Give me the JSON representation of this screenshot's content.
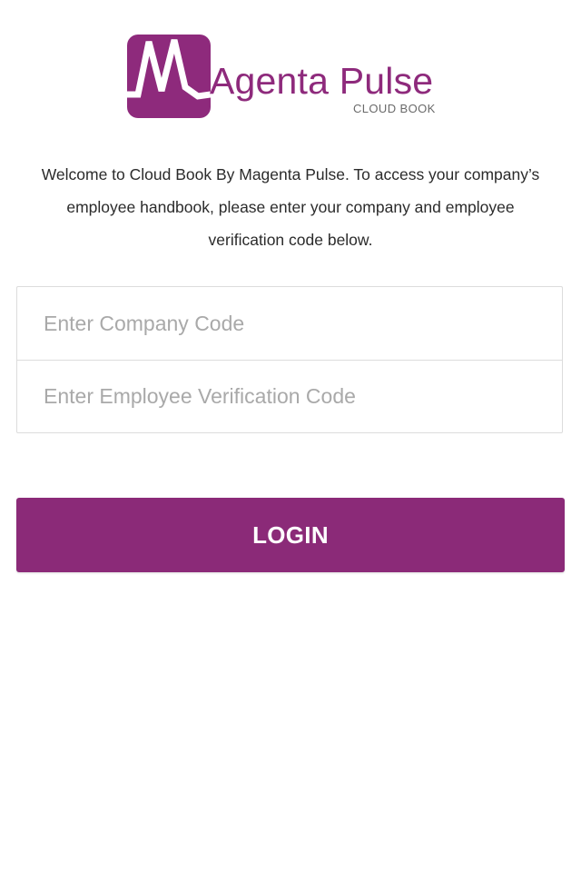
{
  "brand": {
    "name": "Agenta Pulse",
    "subtitle": "CLOUD BOOK",
    "logo_icon": "magenta-m-pulse-icon",
    "color": "#8b2a78"
  },
  "welcome_text": "Welcome to Cloud Book By Magenta Pulse. To access your company’s employee handbook, please enter your company and employee verification code below.",
  "form": {
    "company_code_placeholder": "Enter Company Code",
    "company_code_value": "",
    "employee_code_placeholder": "Enter Employee Verification Code",
    "employee_code_value": ""
  },
  "login_label": "LOGIN"
}
